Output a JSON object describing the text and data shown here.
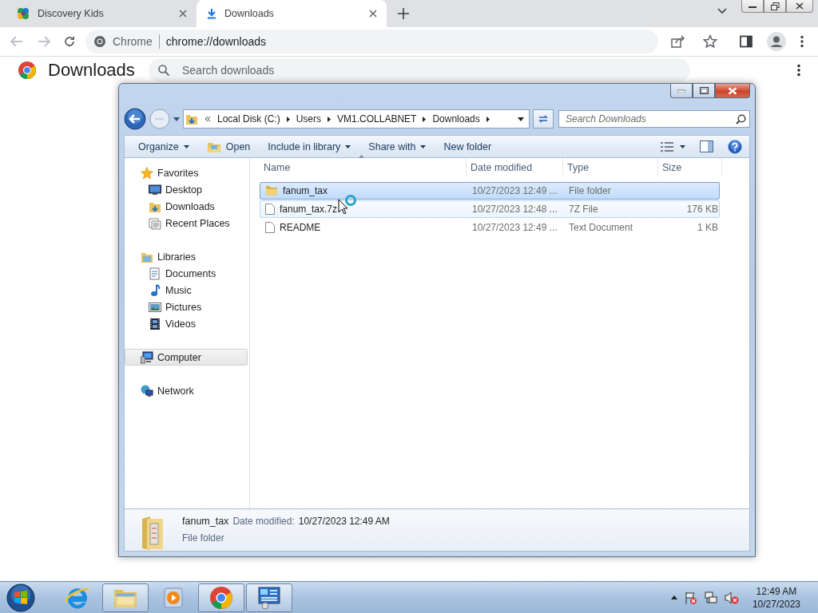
{
  "browser": {
    "tabs": [
      {
        "label": "Discovery Kids",
        "selected": false
      },
      {
        "label": "Downloads",
        "selected": true
      }
    ],
    "address": {
      "chip": "Chrome",
      "url": "chrome://downloads"
    },
    "page": {
      "heading": "Downloads",
      "search": {
        "placeholder": "Search downloads"
      }
    }
  },
  "explorer": {
    "breadcrumbs": [
      "Local Disk (C:)",
      "Users",
      "VM1.COLLABNET",
      "Downloads"
    ],
    "search": {
      "placeholder": "Search Downloads"
    },
    "commands": [
      {
        "label": "Organize",
        "kind": "menu"
      },
      {
        "label": "Open",
        "kind": "icon"
      },
      {
        "label": "Include in library",
        "kind": "menu"
      },
      {
        "label": "Share with",
        "kind": "menu"
      },
      {
        "label": "New folder",
        "kind": "plain"
      }
    ],
    "nav": [
      {
        "label": "Favorites",
        "selected": false,
        "children": [
          {
            "label": "Desktop",
            "selected": false
          },
          {
            "label": "Downloads",
            "selected": false
          },
          {
            "label": "Recent Places",
            "selected": false
          }
        ]
      },
      {
        "label": "Libraries",
        "selected": false,
        "children": [
          {
            "label": "Documents",
            "selected": false
          },
          {
            "label": "Music",
            "selected": false
          },
          {
            "label": "Pictures",
            "selected": false
          },
          {
            "label": "Videos",
            "selected": false
          }
        ]
      },
      {
        "label": "Computer",
        "selected": true
      },
      {
        "label": "Network",
        "selected": false
      }
    ],
    "columns": [
      "Name",
      "Date modified",
      "Type",
      "Size"
    ],
    "rows": [
      {
        "kind": "folder",
        "name": "fanum_tax",
        "date": "10/27/2023 12:49 ...",
        "type": "File folder",
        "size": "",
        "selected": true,
        "hovered": false
      },
      {
        "kind": "file",
        "name": "fanum_tax.7z",
        "date": "10/27/2023 12:48 ...",
        "type": "7Z File",
        "size": "176 KB",
        "selected": false,
        "hovered": true
      },
      {
        "kind": "file",
        "name": "README",
        "date": "10/27/2023 12:49 ...",
        "type": "Text Document",
        "size": "1 KB",
        "selected": false,
        "hovered": false
      }
    ],
    "details": {
      "name": "fanum_tax",
      "date_label": "Date modified:",
      "date": "10/27/2023 12:49 AM",
      "type": "File folder"
    }
  },
  "taskbar": {
    "apps": [
      {
        "running": false
      },
      {
        "running": true
      },
      {
        "running": false
      },
      {
        "running": true
      },
      {
        "running": true
      }
    ],
    "time": "12:49 AM",
    "date": "10/27/2023"
  }
}
